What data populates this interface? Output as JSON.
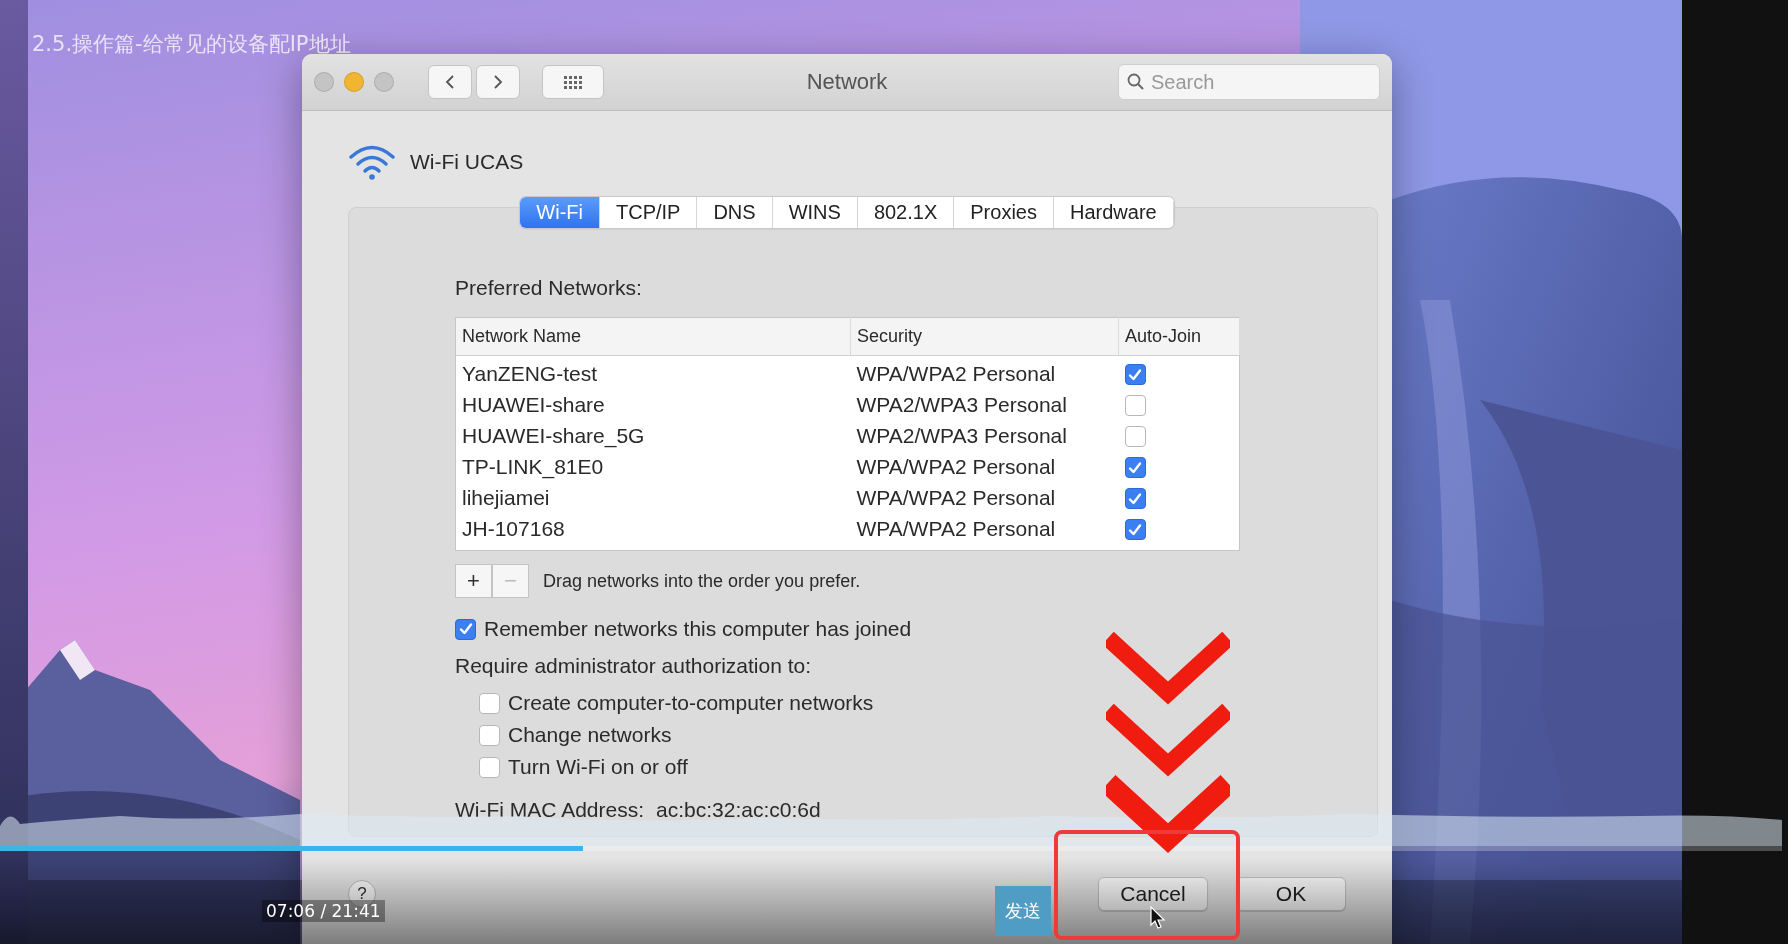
{
  "player": {
    "video_title": "2.5.操作篇-给常见的设备配IP地址",
    "progress": {
      "level": 0.327
    },
    "time": "07:06 / 21:41",
    "send_button": "发送"
  },
  "window": {
    "title": "Network",
    "search": {
      "placeholder": "Search"
    },
    "service": "Wi-Fi UCAS",
    "tabs": [
      {
        "label": "Wi-Fi",
        "selected": true
      },
      {
        "label": "TCP/IP",
        "selected": false
      },
      {
        "label": "DNS",
        "selected": false
      },
      {
        "label": "WINS",
        "selected": false
      },
      {
        "label": "802.1X",
        "selected": false
      },
      {
        "label": "Proxies",
        "selected": false
      },
      {
        "label": "Hardware",
        "selected": false
      }
    ],
    "preferred_label": "Preferred Networks:",
    "table": {
      "columns": [
        "Network Name",
        "Security",
        "Auto-Join"
      ],
      "rows": [
        {
          "name": "YanZENG-test",
          "security": "WPA/WPA2 Personal",
          "auto_join": true
        },
        {
          "name": "HUAWEI-share",
          "security": "WPA2/WPA3 Personal",
          "auto_join": false
        },
        {
          "name": "HUAWEI-share_5G",
          "security": "WPA2/WPA3 Personal",
          "auto_join": false
        },
        {
          "name": "TP-LINK_81E0",
          "security": "WPA/WPA2 Personal",
          "auto_join": true
        },
        {
          "name": "lihejiamei",
          "security": "WPA/WPA2 Personal",
          "auto_join": true
        },
        {
          "name": "JH-107168",
          "security": "WPA/WPA2 Personal",
          "auto_join": true
        }
      ]
    },
    "add_button": {
      "label": "+",
      "disabled": false
    },
    "remove_button": {
      "label": "−",
      "disabled": true
    },
    "drag_hint": "Drag networks into the order you prefer.",
    "remember": {
      "label": "Remember networks this computer has joined",
      "checked": true
    },
    "require_label": "Require administrator authorization to:",
    "require_options": [
      {
        "label": "Create computer-to-computer networks",
        "checked": false
      },
      {
        "label": "Change networks",
        "checked": false
      },
      {
        "label": "Turn Wi-Fi on or off",
        "checked": false
      }
    ],
    "mac": {
      "label": "Wi-Fi MAC Address:",
      "value": "ac:bc:32:ac:c0:6d"
    },
    "help_button": "?",
    "buttons": [
      {
        "label": "Cancel"
      },
      {
        "label": "OK"
      }
    ]
  }
}
